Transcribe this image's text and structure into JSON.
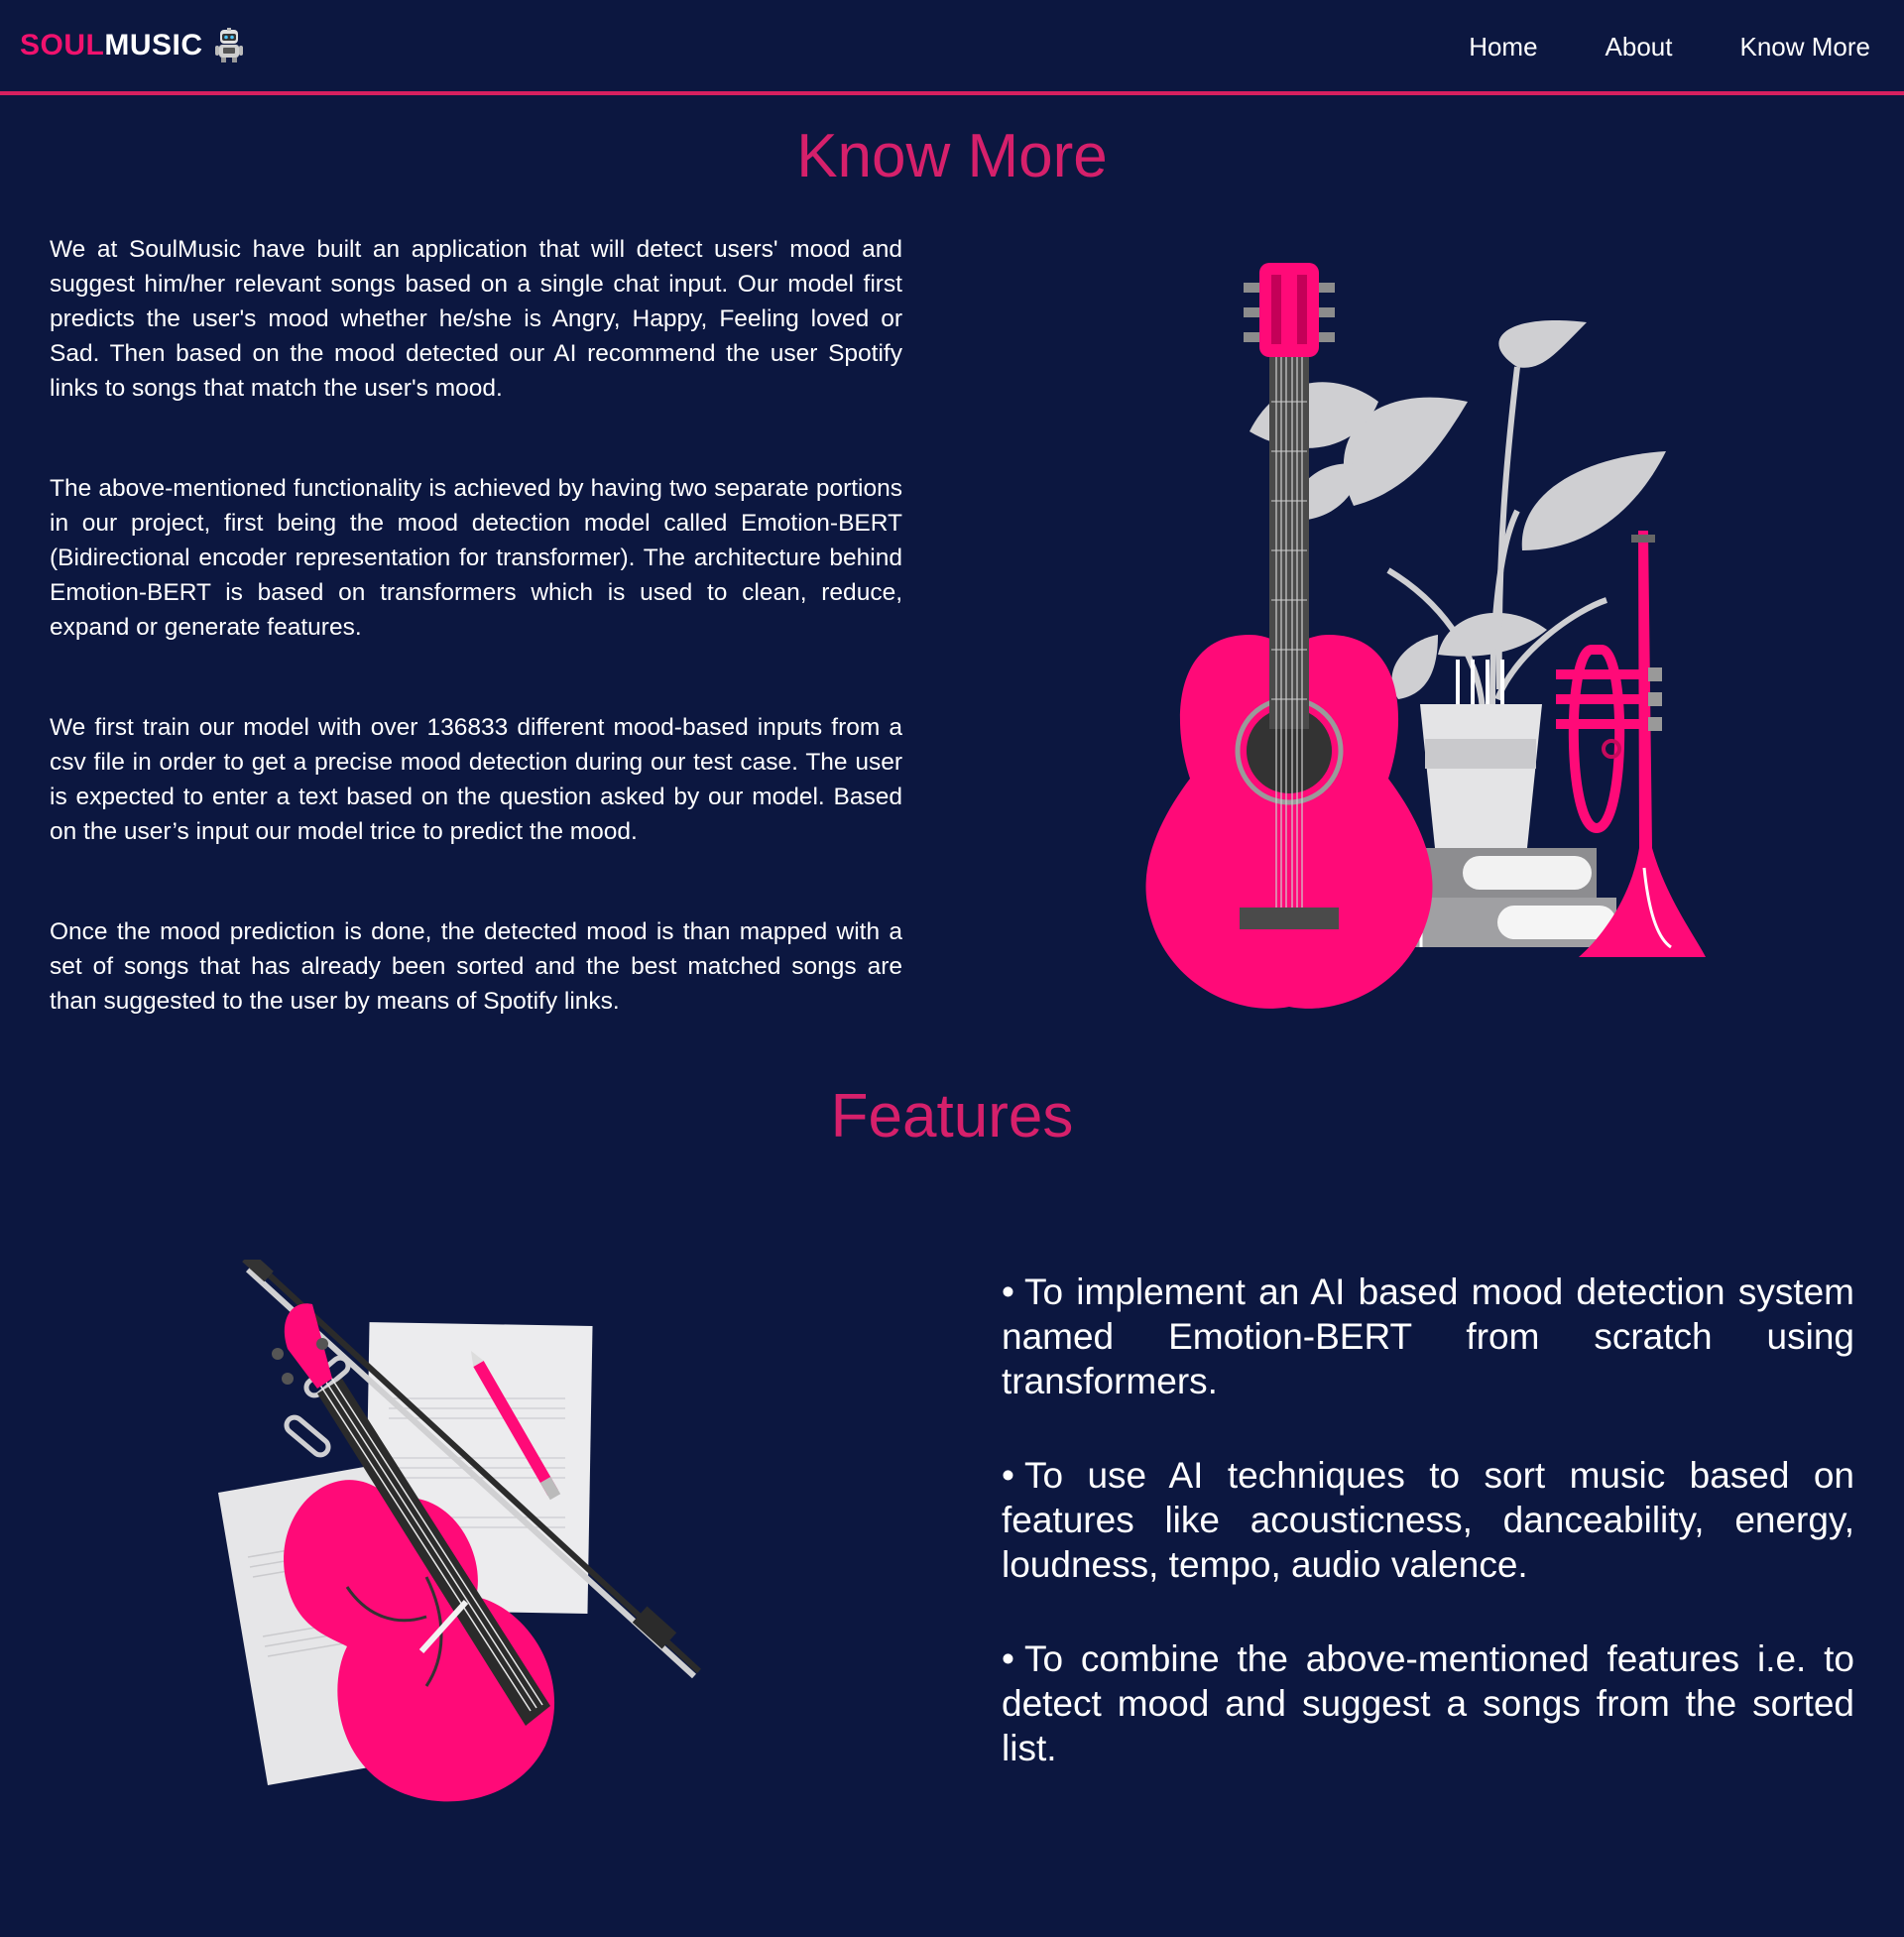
{
  "nav": {
    "brand_part1": "SOUL",
    "brand_part2": "MUSIC",
    "brand_icon": "robot-icon",
    "links": [
      "Home",
      "About",
      "Know More"
    ]
  },
  "know_more": {
    "title": "Know More",
    "paragraphs": [
      "We at SoulMusic have built an application that will detect users' mood and suggest him/her relevant songs based on a single chat input. Our model first predicts the user's mood whether he/she is Angry, Happy, Feeling loved or Sad. Then based on the mood detected our AI recommend the user Spotify links to songs that match the user's mood.",
      "The above-mentioned functionality is achieved by having two separate portions in our project, first being the mood detection model called Emotion-BERT (Bidirectional encoder representation for transformer). The architecture behind Emotion-BERT is based on transformers which is used to clean, reduce, expand or generate features.",
      "We first train our model with over 136833 different mood-based inputs from a csv file in order to get a precise mood detection during our test case. The user is expected to enter a text based on the question asked by our model. Based on the user’s input our model trice to predict the mood.",
      "Once the mood prediction is done, the detected mood is than mapped with a set of songs that has already been sorted and the best matched songs are than suggested to the user by means of Spotify links."
    ]
  },
  "features": {
    "title": "Features",
    "bullet": "•",
    "items": [
      "To implement an AI based mood detection system named Emotion-BERT from scratch using transformers.",
      "To use AI techniques to sort music based on features like acousticness, danceability, energy, loudness, tempo, audio valence.",
      "To combine the above-mentioned features i.e. to detect mood and suggest a songs from the sorted list."
    ]
  },
  "colors": {
    "background": "#0c1740",
    "accent": "#d6206b",
    "brand_pink": "#f0126e",
    "illustration_pink": "#ff0a78",
    "text": "#ffffff"
  }
}
